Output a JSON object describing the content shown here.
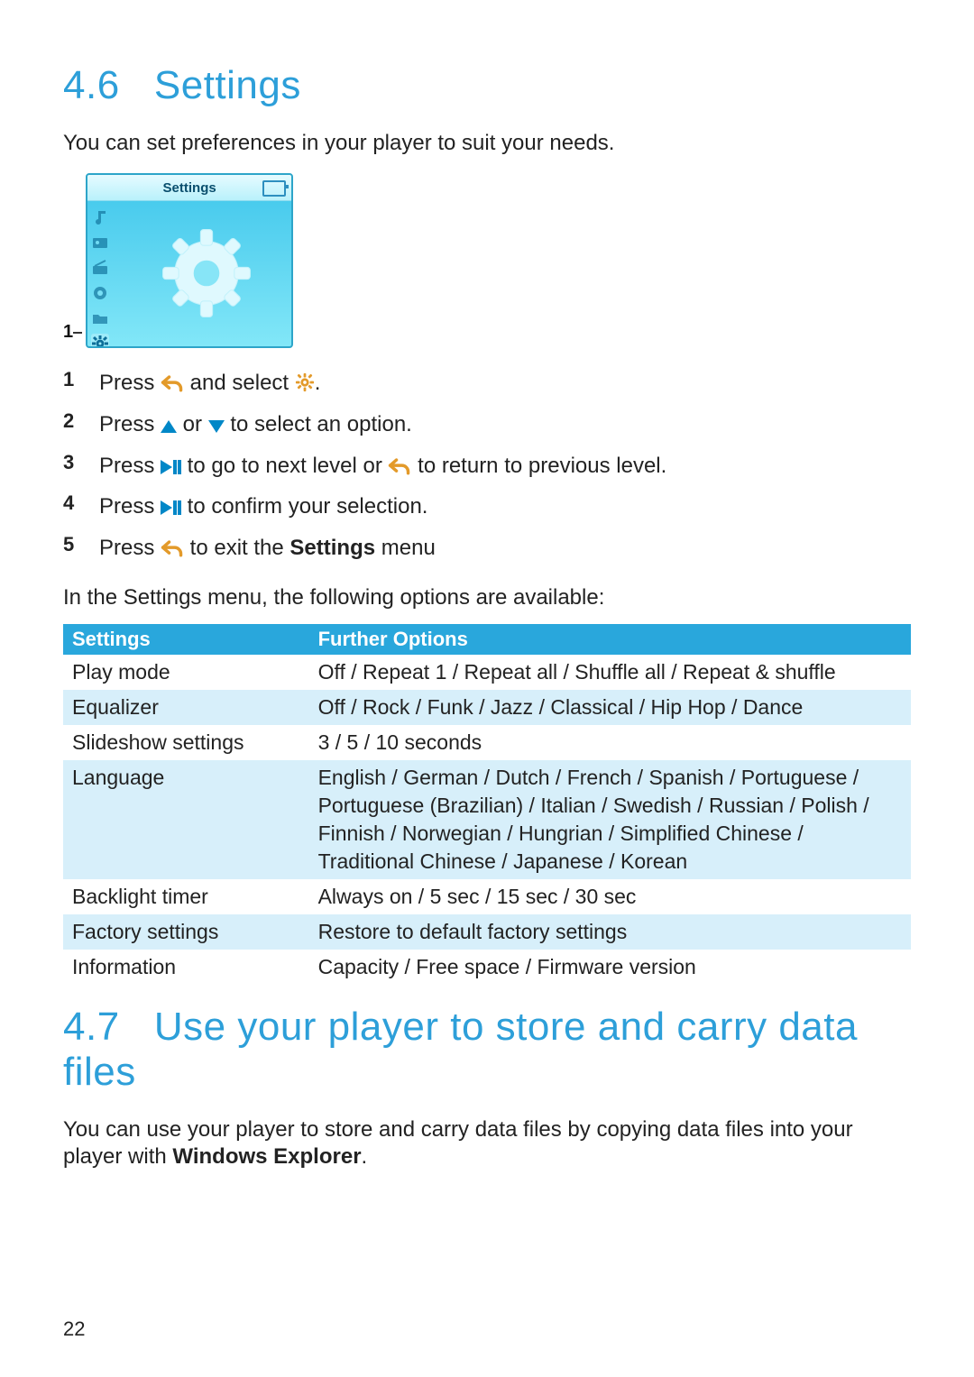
{
  "section46": {
    "number": "4.6",
    "title": "Settings",
    "intro": "You can set preferences in your player to suit your needs.",
    "screenshot": {
      "legend": "1",
      "title": "Settings"
    },
    "steps": [
      {
        "num": "1",
        "parts": [
          {
            "t": "text",
            "v": "Press "
          },
          {
            "t": "icon",
            "v": "back"
          },
          {
            "t": "text",
            "v": " and select "
          },
          {
            "t": "icon",
            "v": "gear"
          },
          {
            "t": "text",
            "v": "."
          }
        ]
      },
      {
        "num": "2",
        "parts": [
          {
            "t": "text",
            "v": "Press "
          },
          {
            "t": "icon",
            "v": "up"
          },
          {
            "t": "text",
            "v": " or "
          },
          {
            "t": "icon",
            "v": "down"
          },
          {
            "t": "text",
            "v": " to select an option."
          }
        ]
      },
      {
        "num": "3",
        "parts": [
          {
            "t": "text",
            "v": "Press "
          },
          {
            "t": "icon",
            "v": "playpause"
          },
          {
            "t": "text",
            "v": " to go to next level or "
          },
          {
            "t": "icon",
            "v": "back"
          },
          {
            "t": "text",
            "v": " to return to previous level."
          }
        ]
      },
      {
        "num": "4",
        "parts": [
          {
            "t": "text",
            "v": "Press "
          },
          {
            "t": "icon",
            "v": "playpause"
          },
          {
            "t": "text",
            "v": " to confirm your selection."
          }
        ]
      },
      {
        "num": "5",
        "parts": [
          {
            "t": "text",
            "v": "Press "
          },
          {
            "t": "icon",
            "v": "back"
          },
          {
            "t": "text",
            "v": " to exit the "
          },
          {
            "t": "bold",
            "v": "Settings"
          },
          {
            "t": "text",
            "v": " menu"
          }
        ]
      }
    ],
    "tableIntro": "In the Settings menu, the following options are available:",
    "table": {
      "head": [
        "Settings",
        "Further Options"
      ],
      "rows": [
        [
          "Play mode",
          "Off / Repeat 1 / Repeat all / Shuffle all / Repeat & shuffle"
        ],
        [
          "Equalizer",
          "Off / Rock / Funk / Jazz / Classical / Hip Hop / Dance"
        ],
        [
          "Slideshow settings",
          "3 / 5 / 10 seconds"
        ],
        [
          "Language",
          "English / German / Dutch / French / Spanish / Portuguese / Portuguese (Brazilian) / Italian / Swedish / Russian / Polish / Finnish / Norwegian / Hungrian / Simplified Chinese / Traditional Chinese / Japanese / Korean"
        ],
        [
          "Backlight timer",
          "Always on / 5 sec / 15 sec / 30 sec"
        ],
        [
          "Factory settings",
          "Restore to default factory settings"
        ],
        [
          "Information",
          "Capacity / Free space / Firmware version"
        ]
      ]
    }
  },
  "section47": {
    "number": "4.7",
    "title": "Use your player to store and carry data files",
    "body_pre": "You can use your player to store and carry data files by copying data files into your player with ",
    "body_bold": "Windows Explorer",
    "body_post": "."
  },
  "pageNumber": "22"
}
